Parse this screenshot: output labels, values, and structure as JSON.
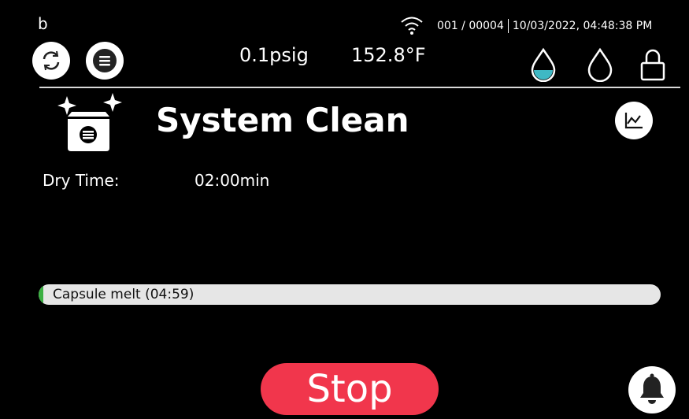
{
  "header": {
    "user_letter": "b",
    "counter": "001 / 00004",
    "datetime": "10/03/2022, 04:48:38 PM",
    "pressure": "0.1psig",
    "temperature": "152.8°F"
  },
  "icons": {
    "wifi": "wifi-icon",
    "refresh": "refresh-icon",
    "menu": "menu-icon",
    "water_drop_filled": "water-drop-filled-icon",
    "water_drop_outline": "water-drop-outline-icon",
    "lock": "lock-icon",
    "system_clean": "system-clean-icon",
    "chart": "chart-icon",
    "bell": "bell-icon"
  },
  "main": {
    "title": "System Clean",
    "dry_time_label": "Dry Time:",
    "dry_time_value": "02:00min"
  },
  "progress": {
    "label": "Capsule melt (04:59)",
    "fraction": 0.008
  },
  "actions": {
    "stop_label": "Stop"
  },
  "colors": {
    "accent_teal": "#3fb8c4",
    "stop_red": "#f1364c",
    "progress_green": "#3cb043"
  }
}
